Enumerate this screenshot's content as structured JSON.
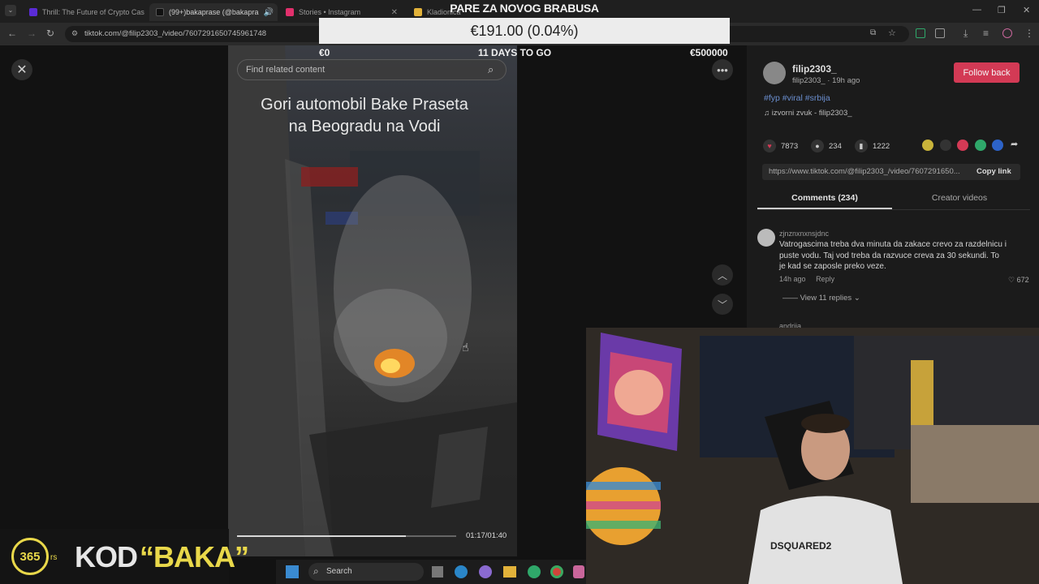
{
  "browser": {
    "tabs": [
      {
        "title": "Thrill: The Future of Crypto Cas",
        "favicon_color": "#5a2bd6"
      },
      {
        "title": "(99+)bakaprase (@bakapra",
        "favicon_color": "#111111"
      },
      {
        "title": "Stories • Instagram",
        "favicon_color": "#e1306c"
      },
      {
        "title": "Kladionica",
        "favicon_color": "#e2b23a"
      }
    ],
    "url": "tiktok.com/@filip2303_/video/7607291650745961748"
  },
  "stream_goal": {
    "title": "PARE ZA NOVOG BRABUSA",
    "amount": "€191.00 (0.04%)",
    "start": "€0",
    "days_left": "11 DAYS TO GO",
    "target": "€500000"
  },
  "video": {
    "search_placeholder": "Find related content",
    "caption_line1": "Gori automobil Bake Praseta",
    "caption_line2": "na Beogradu na Vodi",
    "time": "01:17/01:40",
    "progress": 0.77
  },
  "panel": {
    "author": "filip2303_",
    "author_sub": "filip2303_ · 19h ago",
    "follow_label": "Follow back",
    "tags": "#fyp #viral #srbija",
    "music": "izvorni zvuk - filip2303_",
    "likes": "7873",
    "comments": "234",
    "saves": "1222",
    "link": "https://www.tiktok.com/@filip2303_/video/7607291650...",
    "copy_label": "Copy link",
    "tab_comments": "Comments (234)",
    "tab_creator": "Creator videos"
  },
  "comment": {
    "user": "zjnznxnxnsjdnc",
    "text": "Vatrogascima treba dva minuta da zakace crevo za razdelnicu i puste vodu. Taj vod treba da razvuce creva za 30 sekundi. To je kad se zaposle preko veze.",
    "time": "14h ago",
    "reply": "Reply",
    "likes": "672",
    "view_replies": "View 11 replies"
  },
  "comment2": {
    "user": "andrija"
  },
  "taskbar": {
    "search": "Search"
  },
  "sponsor": {
    "logo": "365",
    "rs": "rs",
    "kod": "KOD",
    "code": "“BAKA”"
  }
}
